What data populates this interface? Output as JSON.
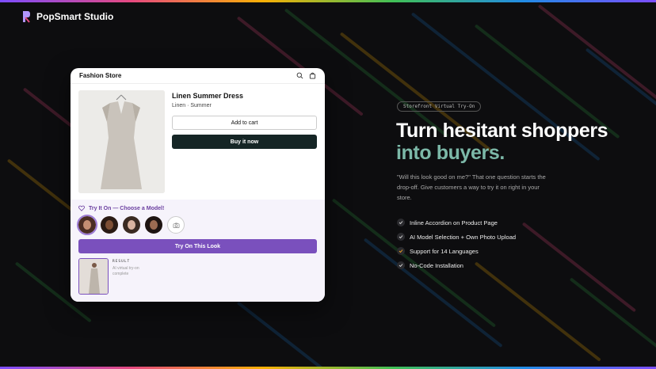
{
  "brand": {
    "name": "PopSmart Studio"
  },
  "store": {
    "name": "Fashion Store",
    "product_title": "Linen Summer Dress",
    "product_subtitle": "Linen · Summer",
    "add_to_cart": "Add to cart",
    "buy_now": "Buy it now"
  },
  "tryon": {
    "title": "Try It On — Choose a Model!",
    "cta": "Try On This Look",
    "result_label": "RESULT",
    "result_desc": "AI virtual try-on complete"
  },
  "hero": {
    "pill": "Storefront Virtual Try-On",
    "headline_line1": "Turn hesitant shoppers",
    "headline_line2": "into buyers.",
    "description": "\"Will this look good on me?\" That one question starts the drop-off. Give customers a way to try it on right in your store.",
    "features": [
      "Inline Accordion on Product Page",
      "AI Model Selection + Own Photo Upload",
      "Support for 14 Languages",
      "No-Code Installation"
    ]
  },
  "colors": {
    "accent": "#7a50bd",
    "headline_accent": "#7cb8a8",
    "background": "#0d0d0f"
  },
  "icons": [
    "search-icon",
    "bag-icon",
    "heart-icon",
    "camera-icon",
    "check-icon"
  ]
}
